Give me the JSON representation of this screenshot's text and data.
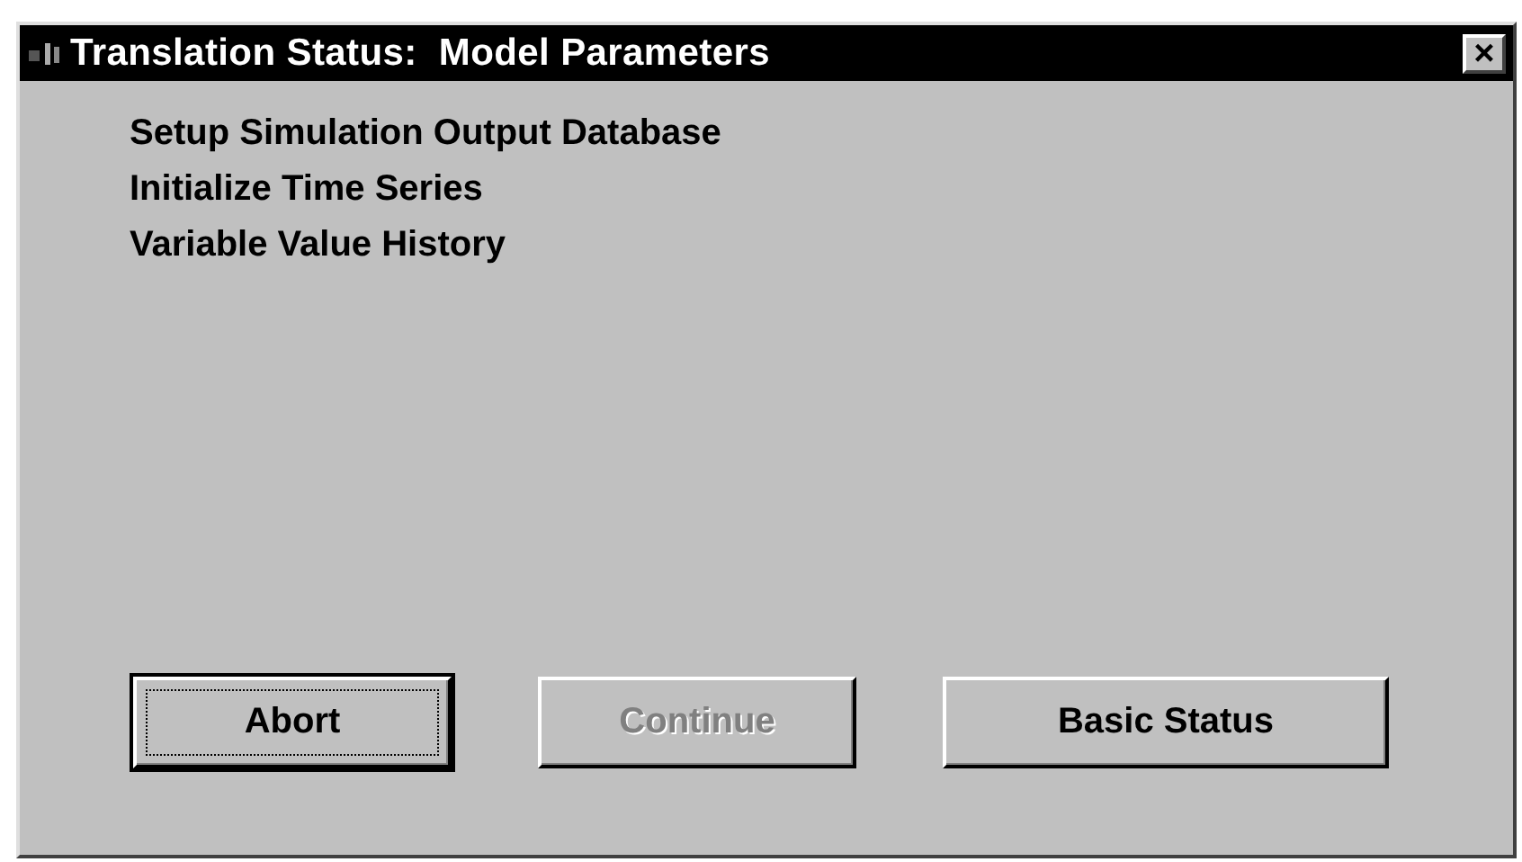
{
  "window": {
    "title": "Translation Status:  Model Parameters",
    "close": "×"
  },
  "steps": [
    "Setup Simulation Output Database",
    "Initialize Time Series",
    "Variable Value History"
  ],
  "buttons": [
    {
      "label": "Abort",
      "focused": true,
      "disabled": false
    },
    {
      "label": "Continue",
      "focused": false,
      "disabled": true
    },
    {
      "label": "Basic Status",
      "focused": false,
      "disabled": false
    }
  ]
}
